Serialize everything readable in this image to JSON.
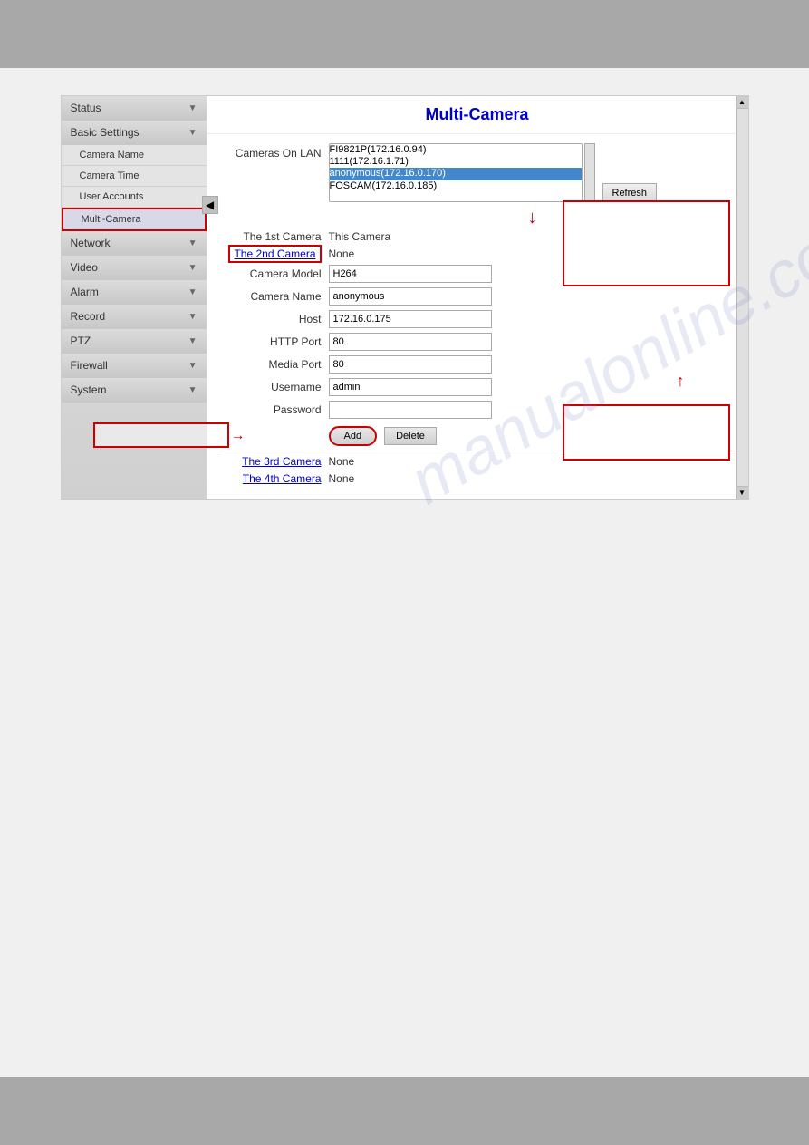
{
  "watermark": "manualonline.com",
  "sidebar": {
    "items": [
      {
        "id": "status",
        "label": "Status",
        "has_arrow": true,
        "active": false,
        "highlighted": false
      },
      {
        "id": "basic-settings",
        "label": "Basic Settings",
        "has_arrow": true,
        "active": false,
        "highlighted": false
      },
      {
        "id": "camera-name",
        "label": "Camera Name",
        "has_arrow": false,
        "active": false,
        "highlighted": false,
        "sub": true
      },
      {
        "id": "camera-time",
        "label": "Camera Time",
        "has_arrow": false,
        "active": false,
        "highlighted": false,
        "sub": true
      },
      {
        "id": "user-accounts",
        "label": "User Accounts",
        "has_arrow": false,
        "active": false,
        "highlighted": false,
        "sub": true
      },
      {
        "id": "multi-camera",
        "label": "Multi-Camera",
        "has_arrow": false,
        "active": true,
        "highlighted": true,
        "sub": true
      },
      {
        "id": "network",
        "label": "Network",
        "has_arrow": true,
        "active": false,
        "highlighted": false
      },
      {
        "id": "video",
        "label": "Video",
        "has_arrow": true,
        "active": false,
        "highlighted": false
      },
      {
        "id": "alarm",
        "label": "Alarm",
        "has_arrow": true,
        "active": false,
        "highlighted": false
      },
      {
        "id": "record",
        "label": "Record",
        "has_arrow": true,
        "active": false,
        "highlighted": false
      },
      {
        "id": "ptz",
        "label": "PTZ",
        "has_arrow": true,
        "active": false,
        "highlighted": false
      },
      {
        "id": "firewall",
        "label": "Firewall",
        "has_arrow": true,
        "active": false,
        "highlighted": false
      },
      {
        "id": "system",
        "label": "System",
        "has_arrow": true,
        "active": false,
        "highlighted": false
      }
    ]
  },
  "main": {
    "title": "Multi-Camera",
    "cameras_on_lan_label": "Cameras On LAN",
    "lan_items": [
      {
        "text": "FI9821P(172.16.0.94)",
        "selected": false
      },
      {
        "text": "1111(172.16.1.71)",
        "selected": false
      },
      {
        "text": "anonymous(172.16.0.170)",
        "selected": true
      },
      {
        "text": "FOSCAM(172.16.0.185)",
        "selected": false
      }
    ],
    "refresh_label": "Refresh",
    "first_camera_label": "The 1st Camera",
    "first_camera_value": "This Camera",
    "second_camera_label": "The 2nd Camera",
    "second_camera_value": "None",
    "camera_model_label": "Camera Model",
    "camera_model_value": "H264",
    "camera_name_label": "Camera Name",
    "camera_name_value": "anonymous",
    "host_label": "Host",
    "host_value": "172.16.0.175",
    "http_port_label": "HTTP Port",
    "http_port_value": "80",
    "media_port_label": "Media Port",
    "media_port_value": "80",
    "username_label": "Username",
    "username_value": "admin",
    "password_label": "Password",
    "password_value": "",
    "add_label": "Add",
    "delete_label": "Delete",
    "third_camera_label": "The 3rd Camera",
    "third_camera_value": "None",
    "fourth_camera_label": "The 4th Camera",
    "fourth_camera_value": "None"
  }
}
